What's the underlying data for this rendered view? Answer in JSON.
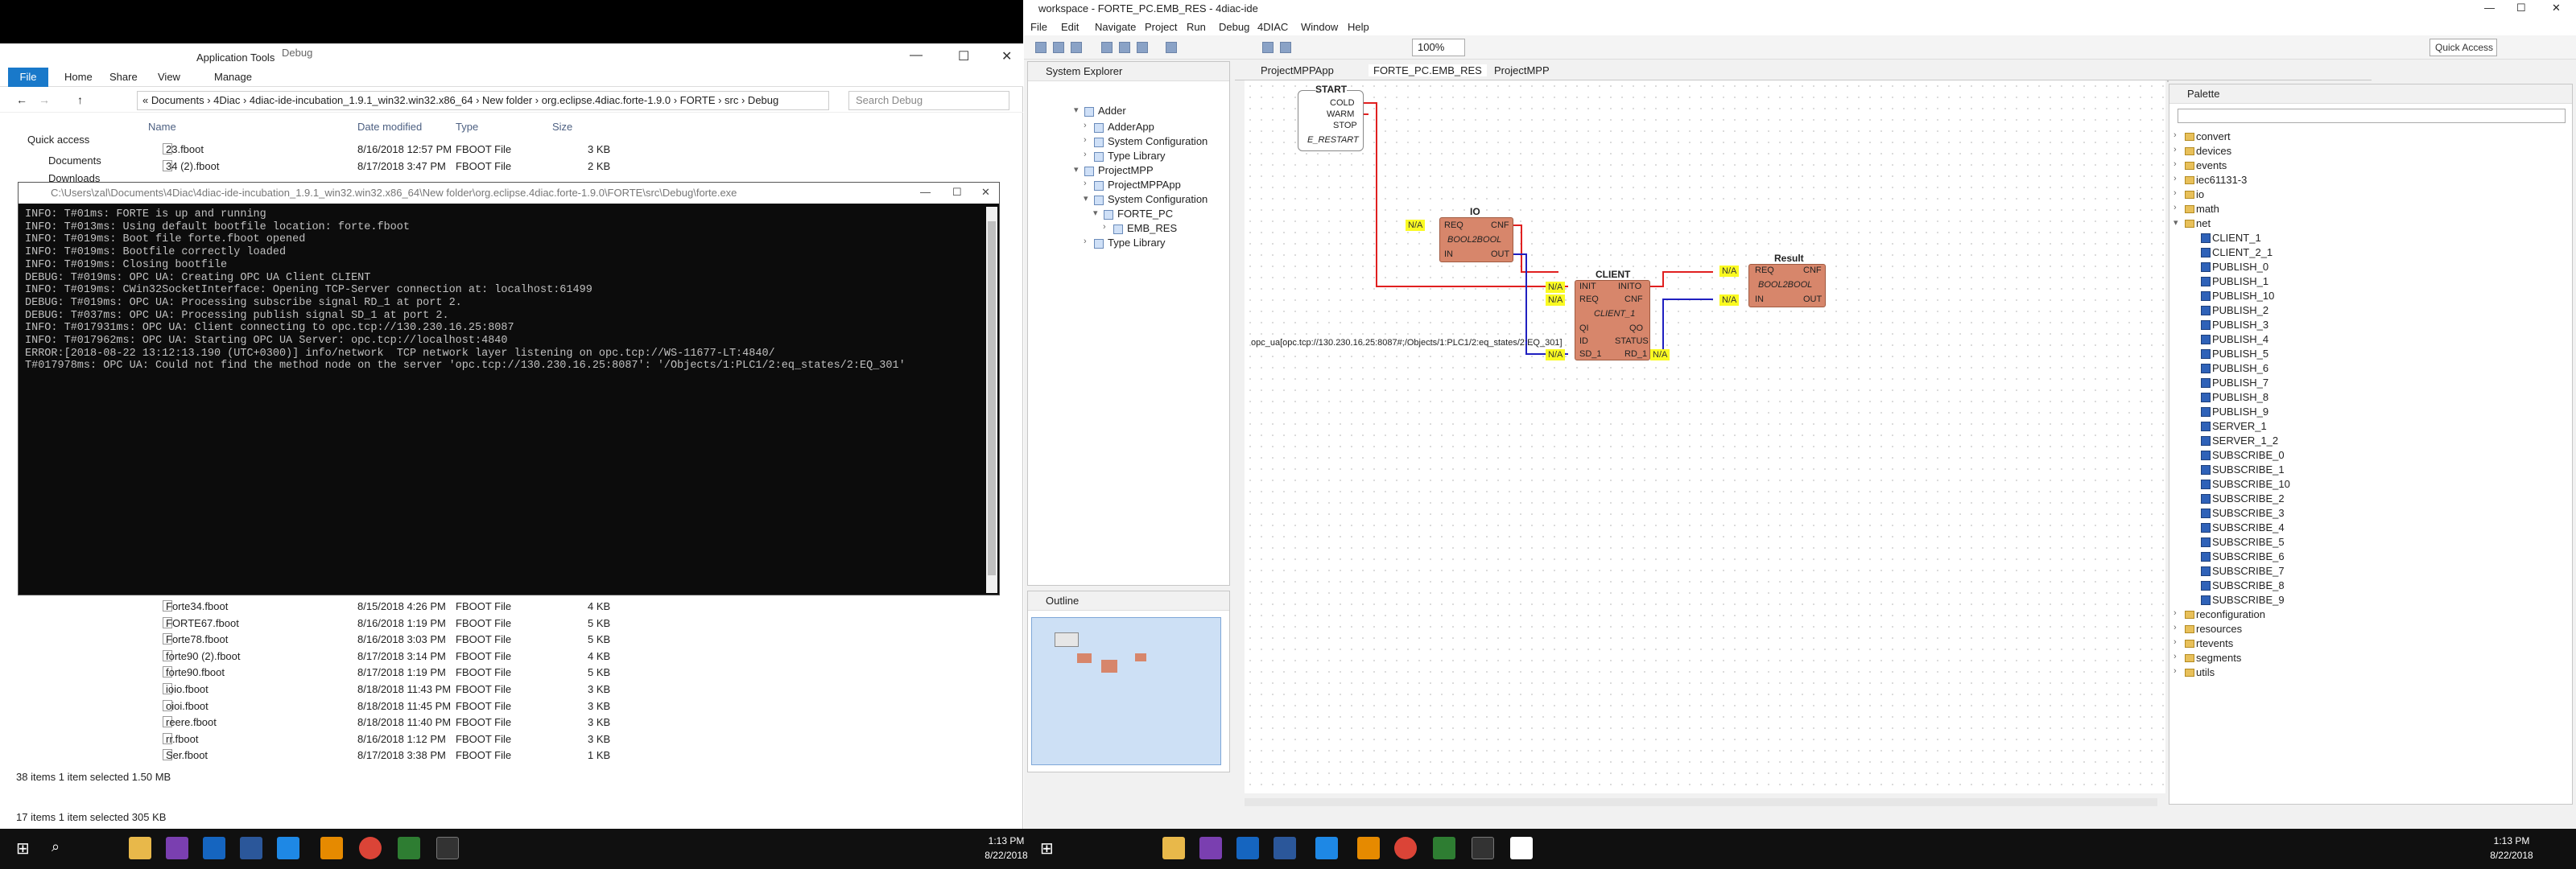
{
  "explorer": {
    "ribbon_context_tab": "Application Tools",
    "ribbon_context_title": "Debug",
    "tabs": {
      "file": "File",
      "home": "Home",
      "share": "Share",
      "view": "View",
      "manage": "Manage"
    },
    "breadcrumb": "« Documents › 4Diac › 4diac-ide-incubation_1.9.1_win32.win32.x86_64 › New folder › org.eclipse.4diac.forte-1.9.0 › FORTE › src › Debug",
    "search_placeholder": "Search Debug",
    "nav": {
      "quick_access": "Quick access",
      "documents": "Documents",
      "downloads": "Downloads"
    },
    "columns": {
      "name": "Name",
      "date": "Date modified",
      "type": "Type",
      "size": "Size"
    },
    "files_top": [
      {
        "name": "23.fboot",
        "date": "8/16/2018 12:57 PM",
        "type": "FBOOT File",
        "size": "3 KB"
      },
      {
        "name": "34 (2).fboot",
        "date": "8/17/2018 3:47 PM",
        "type": "FBOOT File",
        "size": "2 KB"
      }
    ],
    "files_bottom": [
      {
        "name": "Forte34.fboot",
        "date": "8/15/2018 4:26 PM",
        "type": "FBOOT File",
        "size": "4 KB"
      },
      {
        "name": "FORTE67.fboot",
        "date": "8/16/2018 1:19 PM",
        "type": "FBOOT File",
        "size": "5 KB"
      },
      {
        "name": "Forte78.fboot",
        "date": "8/16/2018 3:03 PM",
        "type": "FBOOT File",
        "size": "5 KB"
      },
      {
        "name": "forte90 (2).fboot",
        "date": "8/17/2018 3:14 PM",
        "type": "FBOOT File",
        "size": "4 KB"
      },
      {
        "name": "forte90.fboot",
        "date": "8/17/2018 1:19 PM",
        "type": "FBOOT File",
        "size": "5 KB"
      },
      {
        "name": "ioio.fboot",
        "date": "8/18/2018 11:43 PM",
        "type": "FBOOT File",
        "size": "3 KB"
      },
      {
        "name": "oioi.fboot",
        "date": "8/18/2018 11:45 PM",
        "type": "FBOOT File",
        "size": "3 KB"
      },
      {
        "name": "reere.fboot",
        "date": "8/18/2018 11:40 PM",
        "type": "FBOOT File",
        "size": "3 KB"
      },
      {
        "name": "rr.fboot",
        "date": "8/16/2018 1:12 PM",
        "type": "FBOOT File",
        "size": "3 KB"
      },
      {
        "name": "Ser.fboot",
        "date": "8/17/2018 3:38 PM",
        "type": "FBOOT File",
        "size": "1 KB"
      }
    ],
    "status_inner": "38 items     1 item selected  1.50 MB",
    "status_outer": "17 items     1 item selected  305 KB"
  },
  "console": {
    "title": "C:\\Users\\zal\\Documents\\4Diac\\4diac-ide-incubation_1.9.1_win32.win32.x86_64\\New folder\\org.eclipse.4diac.forte-1.9.0\\FORTE\\src\\Debug\\forte.exe",
    "lines": [
      "INFO: T#01ms: FORTE is up and running",
      "INFO: T#013ms: Using default bootfile location: forte.fboot",
      "INFO: T#019ms: Boot file forte.fboot opened",
      "INFO: T#019ms: Bootfile correctly loaded",
      "INFO: T#019ms: Closing bootfile",
      "DEBUG: T#019ms: OPC UA: Creating OPC UA Client CLIENT",
      "INFO: T#019ms: CWin32SocketInterface: Opening TCP-Server connection at: localhost:61499",
      "DEBUG: T#019ms: OPC UA: Processing subscribe signal RD_1 at port 2.",
      "DEBUG: T#037ms: OPC UA: Processing publish signal SD_1 at port 2.",
      "INFO: T#017931ms: OPC UA: Client connecting to opc.tcp://130.230.16.25:8087",
      "INFO: T#017962ms: OPC UA: Starting OPC UA Server: opc.tcp://localhost:4840",
      "ERROR:[2018-08-22 13:12:13.190 (UTC+0300)] info/network  TCP network layer listening on opc.tcp://WS-11677-LT:4840/",
      "T#017978ms: OPC UA: Could not find the method node on the server 'opc.tcp://130.230.16.25:8087': '/Objects/1:PLC1/2:eq_states/2:EQ_301'"
    ]
  },
  "eclipse": {
    "title": "workspace - FORTE_PC.EMB_RES - 4diac-ide",
    "menu": [
      "File",
      "Edit",
      "Navigate",
      "Project",
      "Run",
      "Debug",
      "4DIAC",
      "Window",
      "Help"
    ],
    "zoom": "100%",
    "quick_access": "Quick Access",
    "system_explorer": {
      "title": "System Explorer",
      "items": [
        "Adder",
        "AdderApp",
        "System Configuration",
        "Type Library",
        "ProjectMPP",
        "ProjectMPPApp",
        "System Configuration",
        "FORTE_PC",
        "EMB_RES",
        "Type Library"
      ]
    },
    "editor_tabs": [
      "ProjectMPPApp",
      "FORTE_PC.EMB_RES",
      "ProjectMPP"
    ],
    "outline_title": "Outline",
    "palette": {
      "title": "Palette",
      "folders_top": [
        "convert",
        "devices",
        "events",
        "iec61131-3",
        "io",
        "math",
        "net"
      ],
      "net_items": [
        "CLIENT_1",
        "CLIENT_2_1",
        "PUBLISH_0",
        "PUBLISH_1",
        "PUBLISH_10",
        "PUBLISH_2",
        "PUBLISH_3",
        "PUBLISH_4",
        "PUBLISH_5",
        "PUBLISH_6",
        "PUBLISH_7",
        "PUBLISH_8",
        "PUBLISH_9",
        "SERVER_1",
        "SERVER_1_2",
        "SUBSCRIBE_0",
        "SUBSCRIBE_1",
        "SUBSCRIBE_10",
        "SUBSCRIBE_2",
        "SUBSCRIBE_3",
        "SUBSCRIBE_4",
        "SUBSCRIBE_5",
        "SUBSCRIBE_6",
        "SUBSCRIBE_7",
        "SUBSCRIBE_8",
        "SUBSCRIBE_9"
      ],
      "folders_bottom": [
        "reconfiguration",
        "resources",
        "rtevents",
        "segments",
        "utils"
      ]
    },
    "fbs": {
      "start": {
        "name": "START",
        "ports": [
          "COLD",
          "WARM",
          "STOP"
        ],
        "type": "E_RESTART"
      },
      "io": {
        "name": "IO",
        "in_event": "REQ",
        "out_event": "CNF",
        "in_data": "IN",
        "out_data": "OUT",
        "type": "BOOL2BOOL"
      },
      "client": {
        "name": "CLIENT",
        "in_events": [
          "INIT",
          "REQ"
        ],
        "out_events": [
          "INITO",
          "CNF"
        ],
        "in_data": [
          "QI",
          "ID",
          "SD_1"
        ],
        "out_data": [
          "QO",
          "STATUS",
          "RD_1"
        ],
        "type": "CLIENT_1"
      },
      "result": {
        "name": "Result",
        "in_event": "REQ",
        "out_event": "CNF",
        "in_data": "IN",
        "out_data": "OUT",
        "type": "BOOL2BOOL"
      },
      "na": "N/A",
      "client_id_param": "opc_ua[opc.tcp://130.230.16.25:8087#;/Objects/1:PLC1/2:eq_states/2:EQ_301]"
    }
  },
  "taskbar": {
    "left_time": "1:13 PM",
    "left_date": "8/22/2018",
    "right_time": "1:13 PM",
    "right_date": "8/22/2018"
  }
}
